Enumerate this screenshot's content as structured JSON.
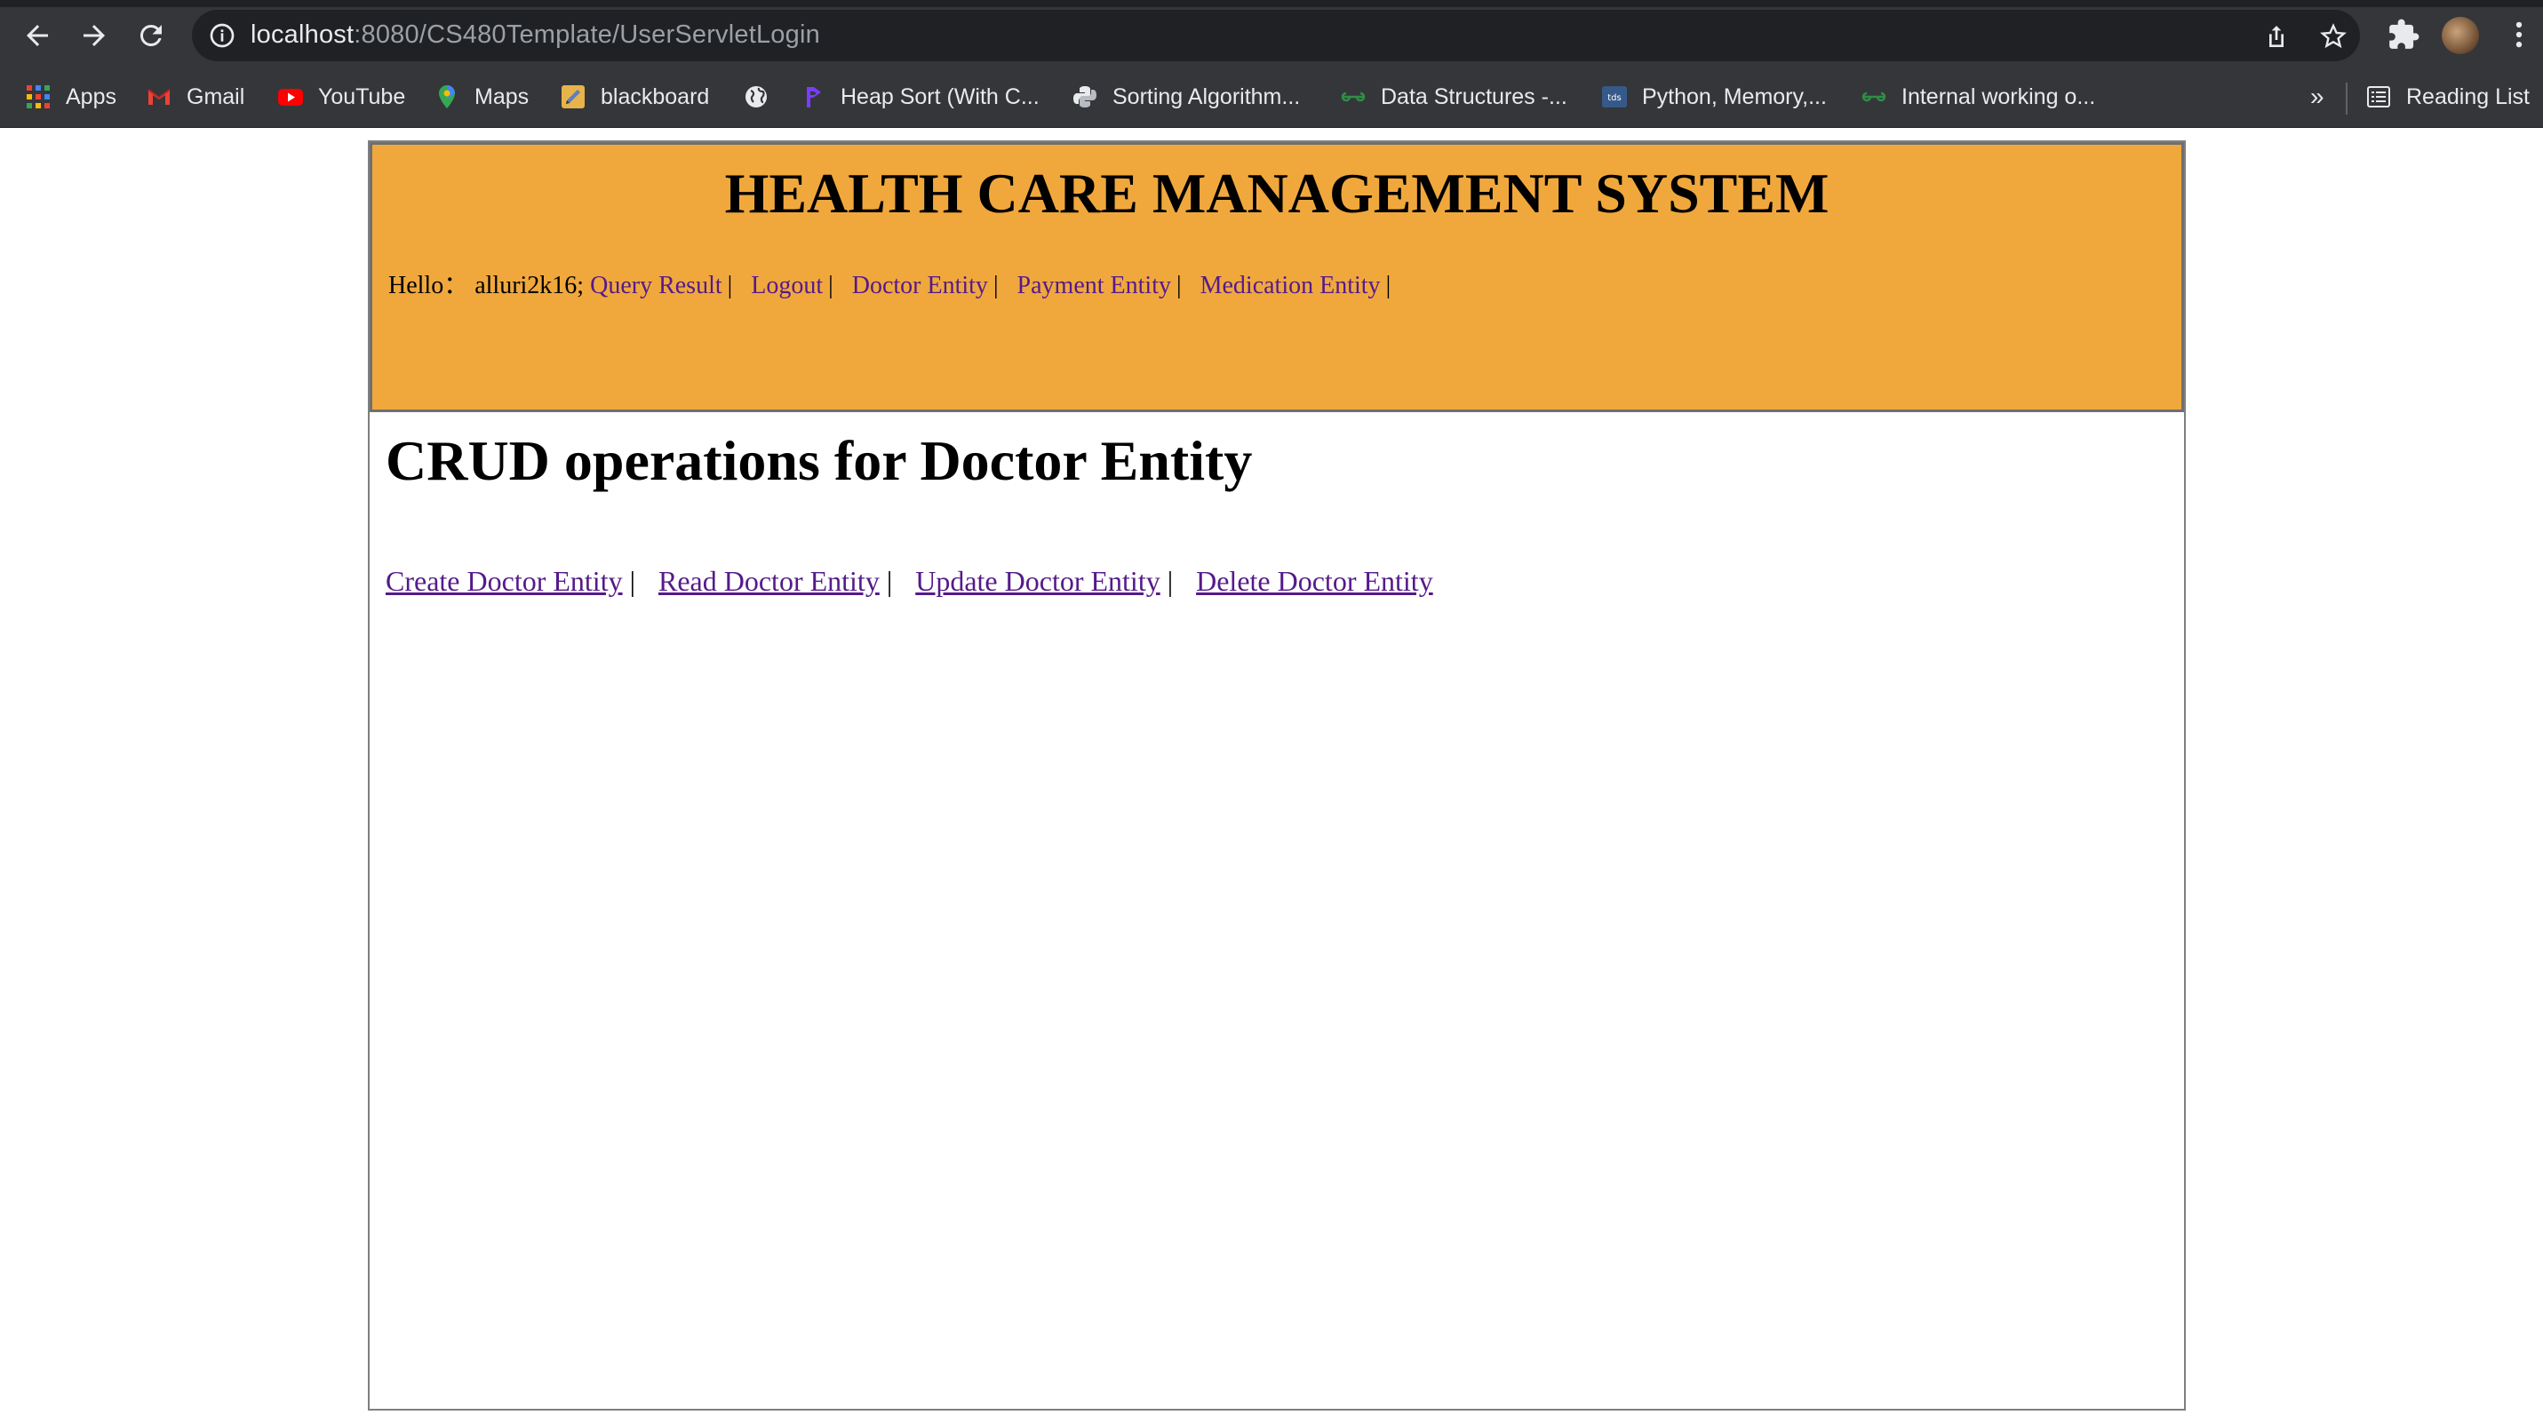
{
  "browser": {
    "url_host": "localhost",
    "url_rest": ":8080/CS480Template/UserServletLogin",
    "bookmarks": [
      {
        "label": "Apps",
        "icon": "apps-grid-icon"
      },
      {
        "label": "Gmail",
        "icon": "gmail-icon"
      },
      {
        "label": "YouTube",
        "icon": "youtube-icon"
      },
      {
        "label": "Maps",
        "icon": "maps-icon"
      },
      {
        "label": "blackboard",
        "icon": "blackboard-icon"
      },
      {
        "label": "",
        "icon": "globe-icon"
      },
      {
        "label": "Heap Sort (With C...",
        "icon": "programiz-icon"
      },
      {
        "label": "Sorting Algorithm...",
        "icon": "python-icon"
      },
      {
        "label": "Data Structures -...",
        "icon": "geeksforgeeks-icon"
      },
      {
        "label": "Python, Memory,...",
        "icon": "tds-icon"
      },
      {
        "label": "Internal working o...",
        "icon": "geeksforgeeks-icon"
      }
    ],
    "overflow_label": "»",
    "reading_list_label": "Reading List"
  },
  "page": {
    "site_title": "HEALTH CARE MANAGEMENT SYSTEM",
    "greeting": "Hello：",
    "username": "alluri2k16;",
    "nav": [
      {
        "label": "Query Result"
      },
      {
        "label": "Logout"
      },
      {
        "label": "Doctor Entity"
      },
      {
        "label": "Payment Entity"
      },
      {
        "label": "Medication Entity"
      }
    ],
    "nav_separator": "|",
    "crud_title": "CRUD operations for Doctor Entity",
    "crud_links": [
      {
        "label": "Create Doctor Entity"
      },
      {
        "label": "Read Doctor Entity"
      },
      {
        "label": "Update Doctor Entity"
      },
      {
        "label": "Delete Doctor Entity"
      }
    ]
  },
  "colors": {
    "header_bg": "#f0a83d",
    "link": "#551a8b",
    "chrome_bg": "#35363a"
  }
}
